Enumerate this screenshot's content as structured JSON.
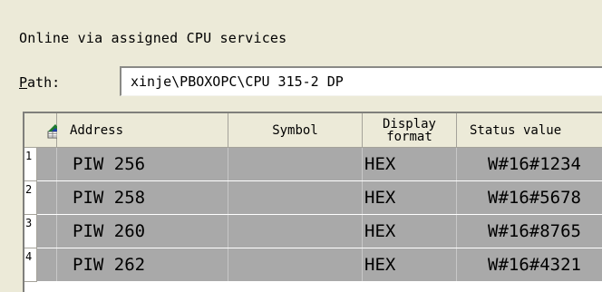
{
  "title": "Online via assigned CPU services",
  "path": {
    "label_hotkey": "P",
    "label_rest": "ath:",
    "value": "xinje\\PBOXOPC\\CPU 315-2 DP"
  },
  "table": {
    "headers": {
      "address": "Address",
      "symbol": "Symbol",
      "display_format": "Display format",
      "status_value": "Status value"
    },
    "rows": [
      {
        "num": "1",
        "address": "PIW  256",
        "symbol": "",
        "format": "HEX",
        "status": "W#16#1234"
      },
      {
        "num": "2",
        "address": "PIW  258",
        "symbol": "",
        "format": "HEX",
        "status": "W#16#5678"
      },
      {
        "num": "3",
        "address": "PIW  260",
        "symbol": "",
        "format": "HEX",
        "status": "W#16#8765"
      },
      {
        "num": "4",
        "address": "PIW  262",
        "symbol": "",
        "format": "HEX",
        "status": "W#16#4321"
      }
    ]
  },
  "colors": {
    "background": "#ecead8",
    "row_highlight": "#a9a9a9",
    "icon_green": "#1f7a2e",
    "icon_blue": "#1e3fa8"
  },
  "icons": {
    "header_corner": "table-select-icon"
  }
}
